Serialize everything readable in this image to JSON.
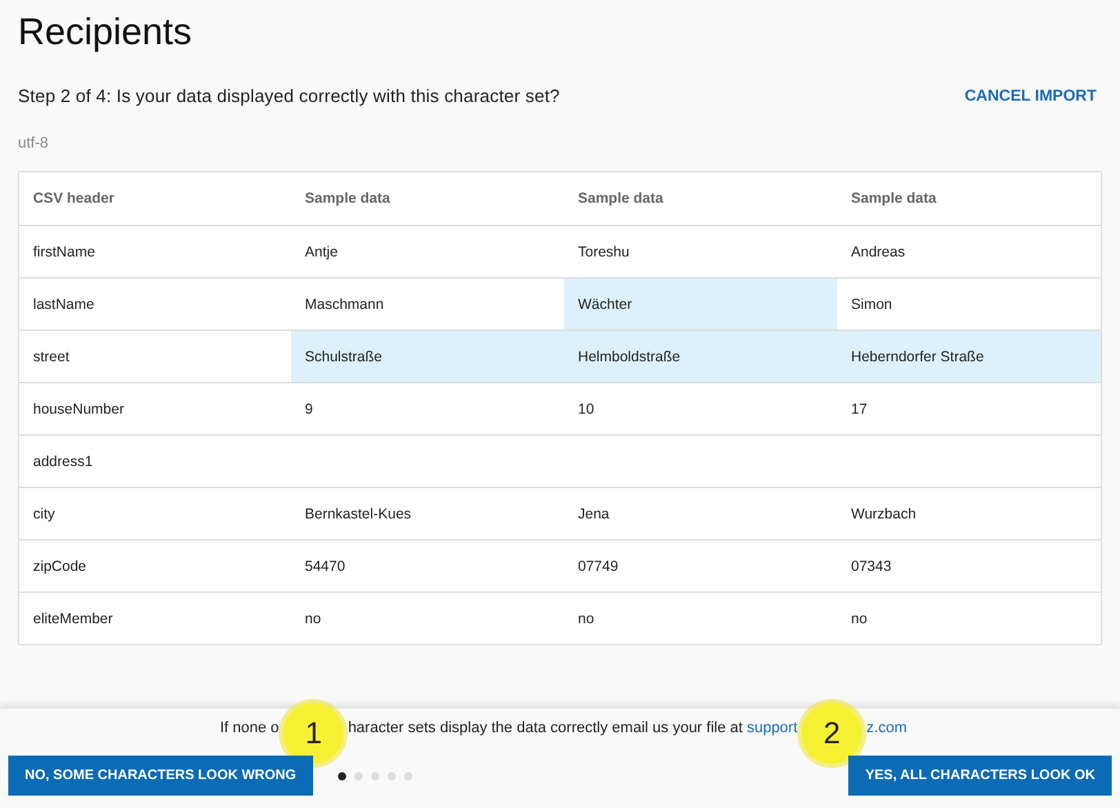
{
  "title": "Recipients",
  "step": "Step 2 of 4: Is your data displayed correctly with this character set?",
  "cancel_link": "CANCEL IMPORT",
  "charset": "utf-8",
  "table": {
    "columns": [
      "CSV header",
      "Sample data",
      "Sample data",
      "Sample data"
    ],
    "rows": [
      {
        "cells": [
          {
            "text": "firstName",
            "highlighted": false
          },
          {
            "text": "Antje",
            "highlighted": false
          },
          {
            "text": "Toreshu",
            "highlighted": false
          },
          {
            "text": "Andreas",
            "highlighted": false
          }
        ]
      },
      {
        "cells": [
          {
            "text": "lastName",
            "highlighted": false
          },
          {
            "text": "Maschmann",
            "highlighted": false
          },
          {
            "text": "Wächter",
            "highlighted": true
          },
          {
            "text": "Simon",
            "highlighted": false
          }
        ]
      },
      {
        "cells": [
          {
            "text": "street",
            "highlighted": false
          },
          {
            "text": "Schulstraße",
            "highlighted": true
          },
          {
            "text": "Helmboldstraße",
            "highlighted": true
          },
          {
            "text": "Heberndorfer Straße",
            "highlighted": true
          }
        ]
      },
      {
        "cells": [
          {
            "text": "houseNumber",
            "highlighted": false
          },
          {
            "text": "9",
            "highlighted": false
          },
          {
            "text": "10",
            "highlighted": false
          },
          {
            "text": "17",
            "highlighted": false
          }
        ]
      },
      {
        "cells": [
          {
            "text": "address1",
            "highlighted": false
          },
          {
            "text": "",
            "highlighted": false
          },
          {
            "text": "",
            "highlighted": false
          },
          {
            "text": "",
            "highlighted": false
          }
        ]
      },
      {
        "cells": [
          {
            "text": "city",
            "highlighted": false
          },
          {
            "text": "Bernkastel-Kues",
            "highlighted": false
          },
          {
            "text": "Jena",
            "highlighted": false
          },
          {
            "text": "Wurzbach",
            "highlighted": false
          }
        ]
      },
      {
        "cells": [
          {
            "text": "zipCode",
            "highlighted": false
          },
          {
            "text": "54470",
            "highlighted": false
          },
          {
            "text": "07749",
            "highlighted": false
          },
          {
            "text": "07343",
            "highlighted": false
          }
        ]
      },
      {
        "cells": [
          {
            "text": "eliteMember",
            "highlighted": false
          },
          {
            "text": "no",
            "highlighted": false
          },
          {
            "text": "no",
            "highlighted": false
          },
          {
            "text": "no",
            "highlighted": false
          }
        ]
      }
    ]
  },
  "footer": {
    "note_start": "If none o",
    "note_end": "haracter sets display the data correctly email us your file at",
    "link_start": "support",
    "link_end": "z.com",
    "no_button": "NO, SOME CHARACTERS LOOK WRONG",
    "yes_button": "YES, ALL CHARACTERS LOOK OK",
    "pager": [
      {
        "selected": true
      },
      {
        "selected": false
      },
      {
        "selected": false
      },
      {
        "selected": false
      },
      {
        "selected": false
      }
    ],
    "callouts": [
      "1",
      "2"
    ]
  }
}
